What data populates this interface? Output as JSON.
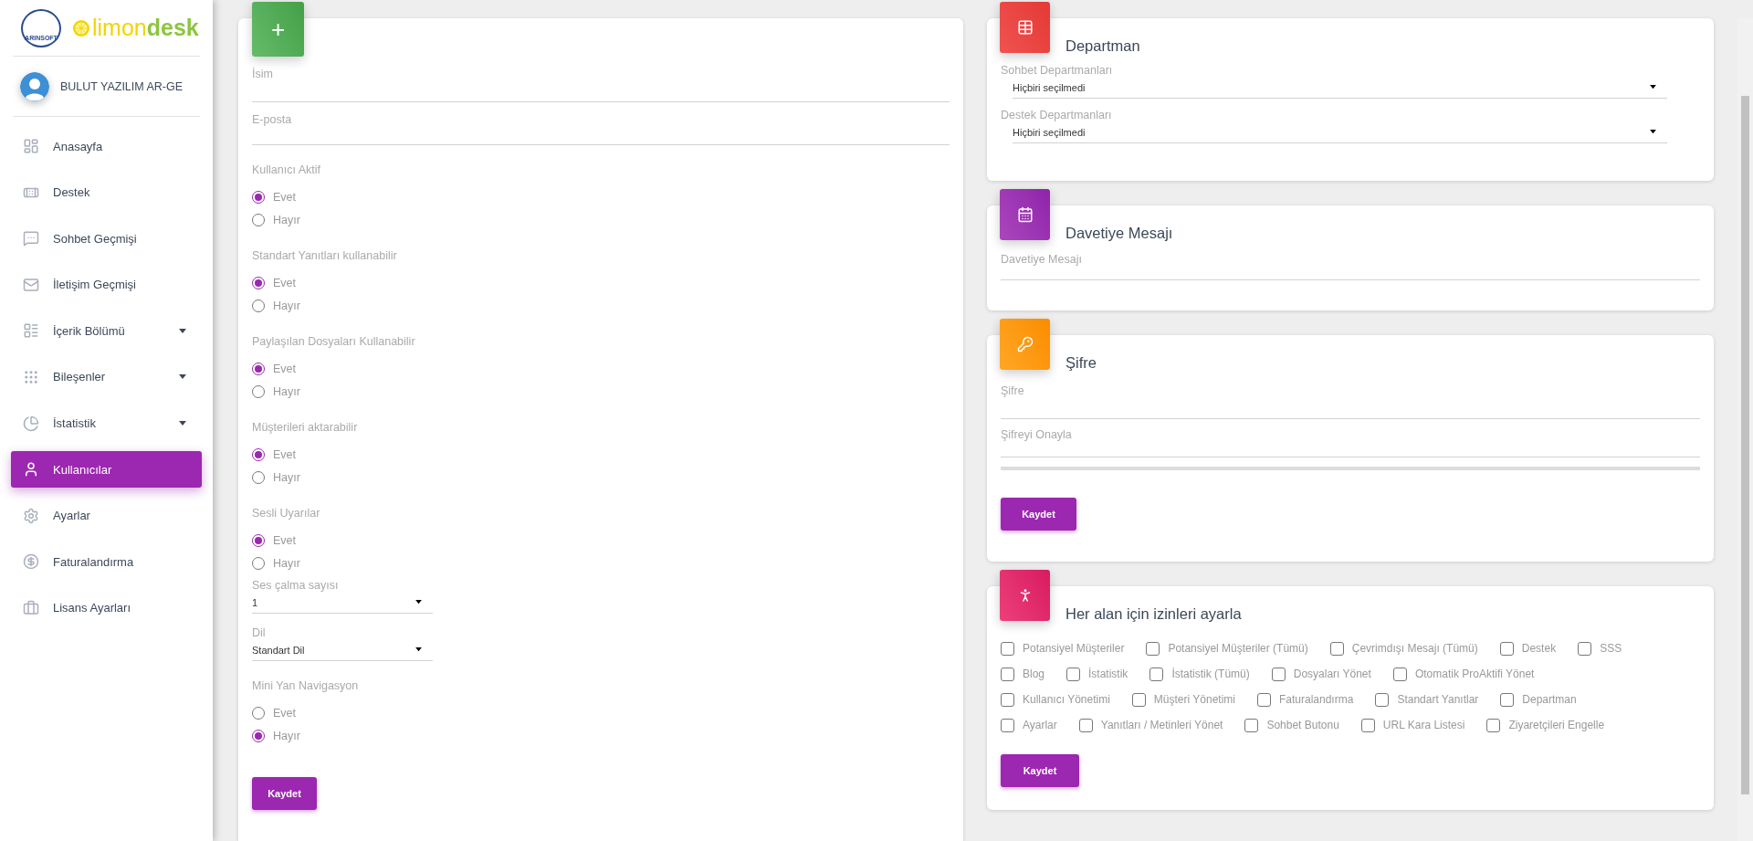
{
  "sidebar": {
    "logo": {
      "company": "ARINSOFT",
      "primary": "limon",
      "secondary": "desk"
    },
    "user": {
      "name": "BULUT YAZILIM AR-GE"
    },
    "items": [
      {
        "label": "Anasayfa",
        "has_submenu": false,
        "selected": false
      },
      {
        "label": "Destek",
        "has_submenu": false,
        "selected": false
      },
      {
        "label": "Sohbet Geçmişi",
        "has_submenu": false,
        "selected": false
      },
      {
        "label": "İletişim Geçmişi",
        "has_submenu": false,
        "selected": false
      },
      {
        "label": "İçerik Bölümü",
        "has_submenu": true,
        "selected": false
      },
      {
        "label": "Bileşenler",
        "has_submenu": true,
        "selected": false
      },
      {
        "label": "İstatistik",
        "has_submenu": true,
        "selected": false
      },
      {
        "label": "Kullanıcılar",
        "has_submenu": false,
        "selected": true
      },
      {
        "label": "Ayarlar",
        "has_submenu": false,
        "selected": false
      },
      {
        "label": "Faturalandırma",
        "has_submenu": false,
        "selected": false
      },
      {
        "label": "Lisans Ayarları",
        "has_submenu": false,
        "selected": false
      }
    ]
  },
  "user_form": {
    "badge": "+",
    "fields": [
      {
        "kind": "text",
        "label": "İsim"
      },
      {
        "kind": "text",
        "label": "E-posta"
      },
      {
        "kind": "radio",
        "label": "Kullanıcı Aktif",
        "options": [
          {
            "label": "Evet",
            "selected": true
          },
          {
            "label": "Hayır",
            "selected": false
          }
        ]
      },
      {
        "kind": "radio",
        "label": "Standart Yanıtları kullanabilir",
        "options": [
          {
            "label": "Evet",
            "selected": true
          },
          {
            "label": "Hayır",
            "selected": false
          }
        ]
      },
      {
        "kind": "radio",
        "label": "Paylaşılan Dosyaları Kullanabilir",
        "options": [
          {
            "label": "Evet",
            "selected": true
          },
          {
            "label": "Hayır",
            "selected": false
          }
        ]
      },
      {
        "kind": "radio",
        "label": "Müşterileri aktarabilir",
        "options": [
          {
            "label": "Evet",
            "selected": true
          },
          {
            "label": "Hayır",
            "selected": false
          }
        ]
      },
      {
        "kind": "radio",
        "label": "Sesli Uyarılar",
        "options": [
          {
            "label": "Evet",
            "selected": true
          },
          {
            "label": "Hayır",
            "selected": false
          }
        ]
      },
      {
        "kind": "select",
        "label": "Ses çalma sayısı",
        "value": "1"
      },
      {
        "kind": "select",
        "label": "Dil",
        "value": "Standart Dil"
      },
      {
        "kind": "radio",
        "label": "Mini Yan Navigasyon",
        "options": [
          {
            "label": "Evet",
            "selected": false
          },
          {
            "label": "Hayır",
            "selected": true
          }
        ]
      }
    ],
    "save": "Kaydet"
  },
  "department": {
    "title": "Departman",
    "selects": [
      {
        "label": "Sohbet Departmanları",
        "value": "Hiçbiri seçilmedi"
      },
      {
        "label": "Destek Departmanları",
        "value": "Hiçbiri seçilmedi"
      }
    ]
  },
  "invitation": {
    "title": "Davetiye Mesajı",
    "field": "Davetiye Mesajı"
  },
  "password": {
    "title": "Şifre",
    "fields": [
      "Şifre",
      "Şifreyi Onayla"
    ],
    "save": "Kaydet"
  },
  "permissions": {
    "title": "Her alan için izinleri ayarla",
    "items": [
      {
        "label": "Potansiyel Müşteriler",
        "checked": false
      },
      {
        "label": "Potansiyel Müşteriler (Tümü)",
        "checked": false
      },
      {
        "label": "Çevrimdışı Mesajı (Tümü)",
        "checked": false
      },
      {
        "label": "Destek",
        "checked": false
      },
      {
        "label": "SSS",
        "checked": false
      },
      {
        "label": "Blog",
        "checked": false
      },
      {
        "label": "İstatistik",
        "checked": false
      },
      {
        "label": "İstatistik (Tümü)",
        "checked": false
      },
      {
        "label": "Dosyaları Yönet",
        "checked": false
      },
      {
        "label": "Otomatik ProAktifi Yönet",
        "checked": false
      },
      {
        "label": "Kullanıcı Yönetimi",
        "checked": false
      },
      {
        "label": "Müşteri Yönetimi",
        "checked": false
      },
      {
        "label": "Faturalandırma",
        "checked": false
      },
      {
        "label": "Standart Yanıtlar",
        "checked": false
      },
      {
        "label": "Departman",
        "checked": false
      },
      {
        "label": "Ayarlar",
        "checked": false
      },
      {
        "label": "Yanıtları / Metinleri Yönet",
        "checked": false
      },
      {
        "label": "Sohbet Butonu",
        "checked": false
      },
      {
        "label": "URL Kara Listesi",
        "checked": false
      },
      {
        "label": "Ziyaretçileri Engelle",
        "checked": false
      }
    ],
    "save": "Kaydet"
  }
}
